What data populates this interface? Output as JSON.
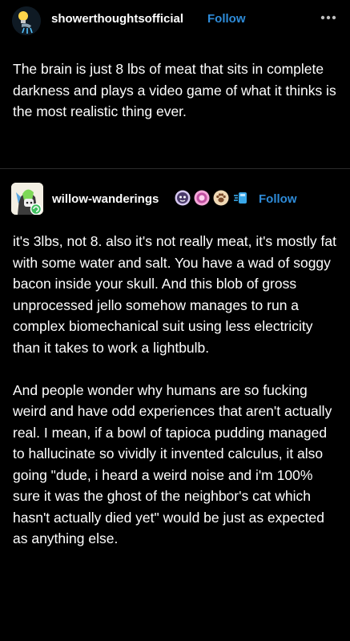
{
  "original_post": {
    "username": "showerthoughtsofficial",
    "follow_label": "Follow",
    "avatar_icon": "showerhead-lightbulb-icon",
    "more_icon": "more-options-icon",
    "text": "The brain is just 8 lbs of meat that sits in complete darkness and plays a video game of what it thinks is the most realistic thing ever."
  },
  "reply": {
    "username": "willow-wanderings",
    "follow_label": "Follow",
    "avatar_icon": "character-avatar-icon",
    "badges": [
      "purple-badge-icon",
      "pink-badge-icon",
      "paw-badge-icon",
      "blue-badge-icon"
    ],
    "paragraphs": [
      "it's 3lbs, not 8. also it's not really meat, it's mostly fat with some water and salt. You have a wad of soggy bacon inside your skull. And this blob of gross unprocessed jello somehow manages to run a complex biomechanical suit using less electricity than it takes to work a lightbulb.",
      "And people wonder why humans are so fucking weird and have odd experiences that aren't actually real. I mean, if a bowl of tapioca pudding managed to hallucinate so vividly it invented calculus, it also going \"dude, i heard a weird noise and i'm 100% sure it was the ghost of the neighbor's cat which hasn't actually died yet\" would be just as expected as anything else."
    ]
  },
  "colors": {
    "background": "#000000",
    "text": "#ffffff",
    "follow": "#2e8bd8",
    "divider": "#2b2b2b"
  }
}
